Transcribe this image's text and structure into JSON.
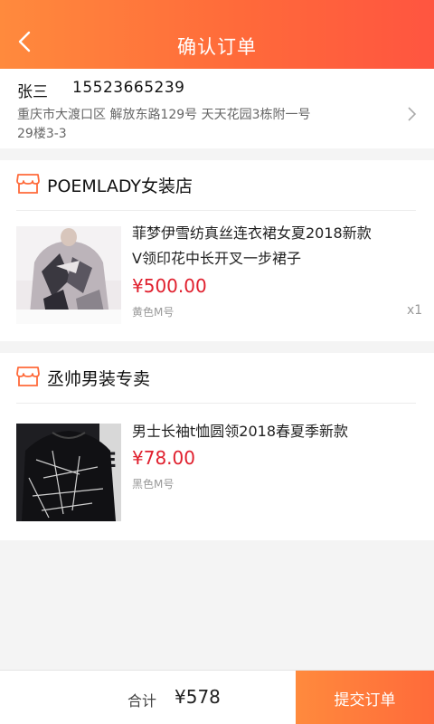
{
  "header": {
    "title": "确认订单",
    "back_icon": "back-arrow-icon"
  },
  "address": {
    "name": "张三",
    "phone": "15523665239",
    "line1": "重庆市大渡口区 解放东路129号 天天花园3栋附一号",
    "line2": "29楼3-3"
  },
  "shops": [
    {
      "name": "POEMLADY女装店",
      "icon": "store-icon",
      "product": {
        "title_line1": "菲梦伊雪纺真丝连衣裙女夏2018新款",
        "title_line2": "V领印花中长开叉一步裙子",
        "price": "¥500.00",
        "spec": "黄色M号",
        "qty": "x1"
      }
    },
    {
      "name": "丞帅男装专卖",
      "icon": "store-icon",
      "product": {
        "title_line1": "男士长袖t恤圆领2018春夏季新款",
        "price": "¥78.00",
        "spec": "黑色M号"
      }
    }
  ],
  "footer": {
    "total_label": "合计",
    "total_value": "¥578",
    "submit_label": "提交订单"
  },
  "colors": {
    "accent": "#ff6a3a",
    "price": "#e0202e"
  }
}
